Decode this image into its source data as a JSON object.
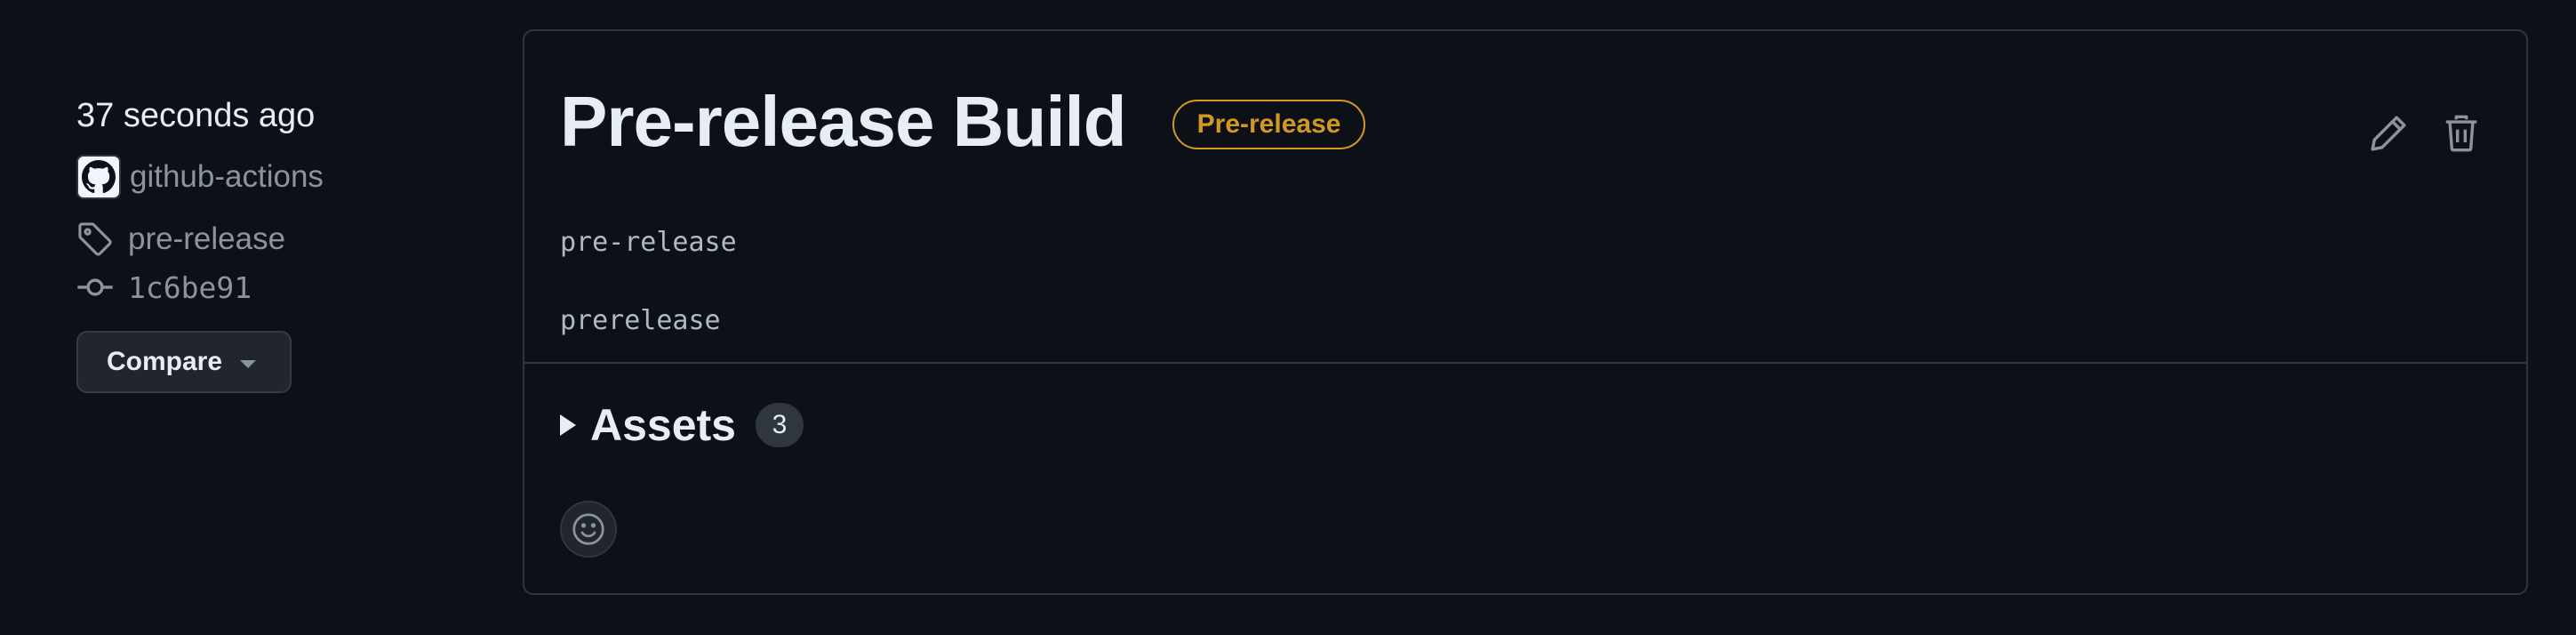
{
  "sidebar": {
    "time": "37 seconds ago",
    "author": "github-actions",
    "tag": "pre-release",
    "commit": "1c6be91",
    "compare_label": "Compare"
  },
  "release": {
    "title": "Pre-release Build",
    "badge": "Pre-release",
    "body_lines": [
      "pre-release",
      "prerelease"
    ],
    "assets_label": "Assets",
    "assets_count": "3"
  },
  "icons": {
    "avatar": "github-mark-icon",
    "tag": "tag-icon",
    "commit": "git-commit-icon",
    "edit": "pencil-icon",
    "delete": "trash-icon",
    "reaction": "smiley-icon"
  },
  "colors": {
    "background": "#0d1117",
    "border": "#30363d",
    "badge": "#d29922",
    "muted": "#8b949e"
  }
}
